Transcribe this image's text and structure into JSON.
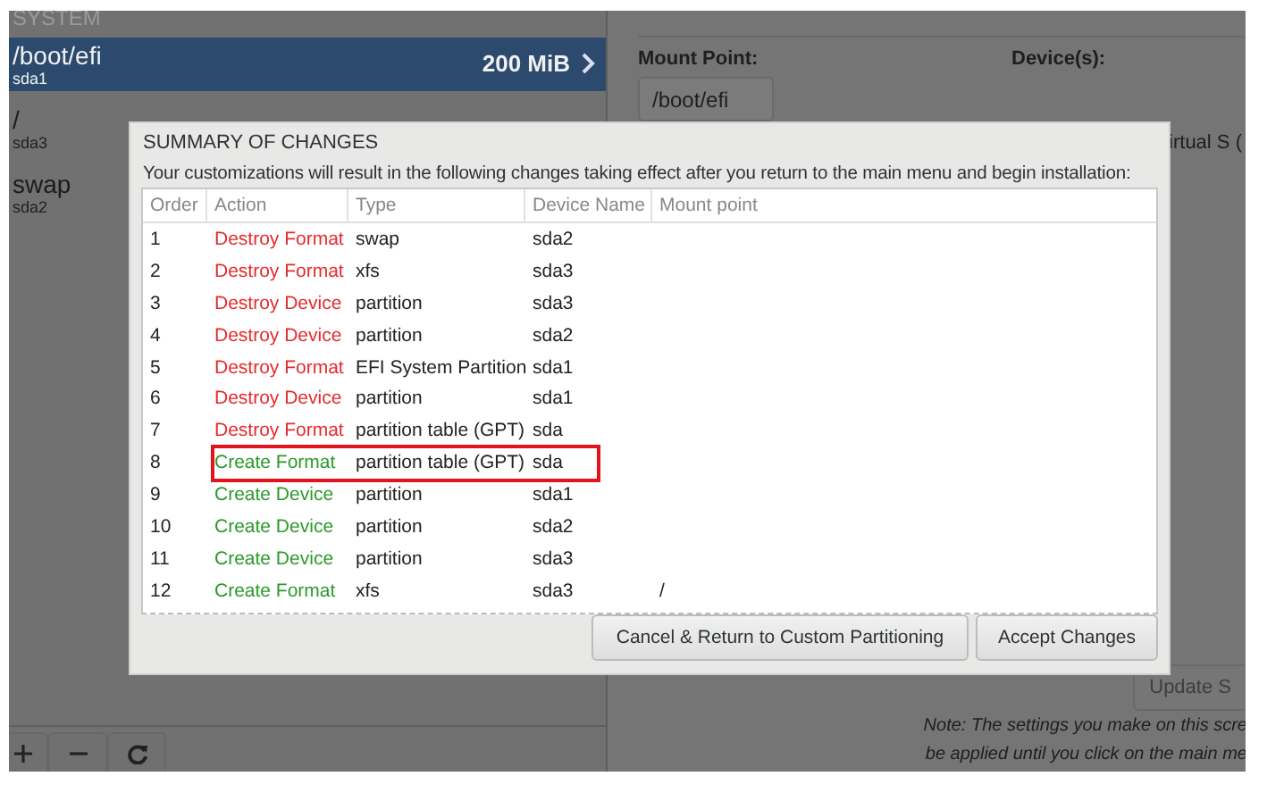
{
  "partitions": {
    "section": "SYSTEM",
    "mounts": [
      {
        "name": "/boot/efi",
        "device": "sda1",
        "size": "200 MiB",
        "selected": true
      },
      {
        "name": "/",
        "device": "sda3",
        "selected": false
      },
      {
        "name": "swap",
        "device": "sda2",
        "selected": false
      }
    ]
  },
  "details": {
    "mount_point_label": "Mount Point:",
    "mount_point": "/boot/efi",
    "devices_label": "Device(s):",
    "device_text": "irtual S (",
    "update_button": "Update S",
    "note": [
      "Note:  The settings you make on this scre",
      "be applied until you click on the main me"
    ]
  },
  "dialog": {
    "title": "SUMMARY OF CHANGES",
    "message": "Your customizations will result in the following changes taking effect after you return to the main menu and begin installation:",
    "columns": [
      "Order",
      "Action",
      "Type",
      "Device Name",
      "Mount point"
    ],
    "rows": [
      {
        "order": "1",
        "action": "Destroy Format",
        "kind": "destroy",
        "type": "swap",
        "device": "sda2",
        "highlighted": false
      },
      {
        "order": "2",
        "action": "Destroy Format",
        "kind": "destroy",
        "type": "xfs",
        "device": "sda3",
        "highlighted": false
      },
      {
        "order": "3",
        "action": "Destroy Device",
        "kind": "destroy",
        "type": "partition",
        "device": "sda3",
        "highlighted": false
      },
      {
        "order": "4",
        "action": "Destroy Device",
        "kind": "destroy",
        "type": "partition",
        "device": "sda2",
        "highlighted": false
      },
      {
        "order": "5",
        "action": "Destroy Format",
        "kind": "destroy",
        "type": "EFI System Partition",
        "device": "sda1",
        "highlighted": false
      },
      {
        "order": "6",
        "action": "Destroy Device",
        "kind": "destroy",
        "type": "partition",
        "device": "sda1",
        "highlighted": false
      },
      {
        "order": "7",
        "action": "Destroy Format",
        "kind": "destroy",
        "type": "partition table (GPT)",
        "device": "sda",
        "highlighted": false
      },
      {
        "order": "8",
        "action": "Create Format",
        "kind": "create",
        "type": "partition table (GPT)",
        "device": "sda",
        "highlighted": true
      },
      {
        "order": "9",
        "action": "Create Device",
        "kind": "create",
        "type": "partition",
        "device": "sda1",
        "highlighted": false
      },
      {
        "order": "10",
        "action": "Create Device",
        "kind": "create",
        "type": "partition",
        "device": "sda2",
        "highlighted": false
      },
      {
        "order": "11",
        "action": "Create Device",
        "kind": "create",
        "type": "partition",
        "device": "sda3",
        "highlighted": false
      },
      {
        "order": "12",
        "action": "Create Format",
        "kind": "create",
        "type": "xfs",
        "device": "sda3",
        "mount": "/",
        "highlighted": false
      }
    ],
    "buttons": [
      {
        "label": "Cancel & Return to Custom Partitioning",
        "kind": "cancel"
      },
      {
        "label": "Accept Changes",
        "kind": "accept"
      }
    ]
  }
}
